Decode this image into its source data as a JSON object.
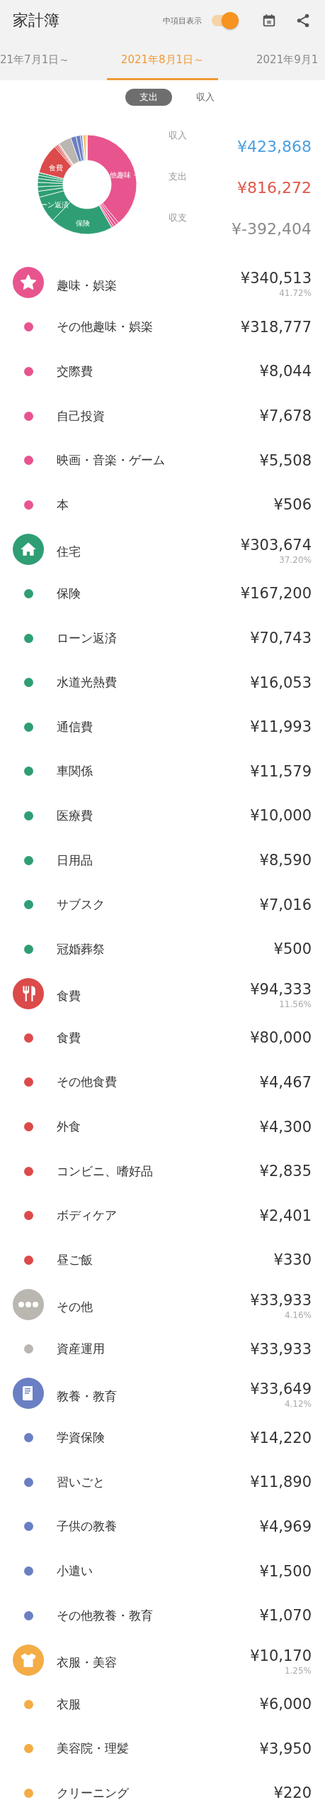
{
  "app_bar": {
    "title": "家計簿",
    "toggle": {
      "label": "中項目表示",
      "on": true
    }
  },
  "period_tabs": [
    {
      "label": "21年7月1日～",
      "selected": false
    },
    {
      "label": "2021年8月1日～",
      "selected": true
    },
    {
      "label": "2021年9月1",
      "selected": false
    }
  ],
  "mode_tabs": [
    {
      "label": "支出",
      "selected": true
    },
    {
      "label": "収入",
      "selected": false
    }
  ],
  "donut_labels": [
    "食費",
    "他趣味・",
    "ーン返済",
    "保険"
  ],
  "summary": [
    {
      "label": "収入",
      "value": "¥423,868",
      "kind": "income"
    },
    {
      "label": "支出",
      "value": "¥816,272",
      "kind": "expense"
    },
    {
      "label": "収支",
      "value": "¥-392,404",
      "kind": "balance"
    }
  ],
  "categories": [
    {
      "name": "趣味・娯楽",
      "amount": "¥340,513",
      "percent": "41.72%",
      "color": "#e8548e",
      "items": [
        {
          "name": "その他趣味・娯楽",
          "amount": "¥318,777"
        },
        {
          "name": "交際費",
          "amount": "¥8,044"
        },
        {
          "name": "自己投資",
          "amount": "¥7,678"
        },
        {
          "name": "映画・音楽・ゲーム",
          "amount": "¥5,508"
        },
        {
          "name": "本",
          "amount": "¥506"
        }
      ]
    },
    {
      "name": "住宅",
      "amount": "¥303,674",
      "percent": "37.20%",
      "color": "#2f9e74",
      "items": [
        {
          "name": "保険",
          "amount": "¥167,200"
        },
        {
          "name": "ローン返済",
          "amount": "¥70,743"
        },
        {
          "name": "水道光熱費",
          "amount": "¥16,053"
        },
        {
          "name": "通信費",
          "amount": "¥11,993"
        },
        {
          "name": "車関係",
          "amount": "¥11,579"
        },
        {
          "name": "医療費",
          "amount": "¥10,000"
        },
        {
          "name": "日用品",
          "amount": "¥8,590"
        },
        {
          "name": "サブスク",
          "amount": "¥7,016"
        },
        {
          "name": "冠婚葬祭",
          "amount": "¥500"
        }
      ]
    },
    {
      "name": "食費",
      "amount": "¥94,333",
      "percent": "11.56%",
      "color": "#dc4a4a",
      "items": [
        {
          "name": "食費",
          "amount": "¥80,000"
        },
        {
          "name": "その他食費",
          "amount": "¥4,467"
        },
        {
          "name": "外食",
          "amount": "¥4,300"
        },
        {
          "name": "コンビニ、嗜好品",
          "amount": "¥2,835"
        },
        {
          "name": "ボディケア",
          "amount": "¥2,401"
        },
        {
          "name": "昼ご飯",
          "amount": "¥330"
        }
      ]
    },
    {
      "name": "その他",
      "amount": "¥33,933",
      "percent": "4.16%",
      "color": "#bab6b0",
      "items": [
        {
          "name": "資産運用",
          "amount": "¥33,933"
        }
      ]
    },
    {
      "name": "教養・教育",
      "amount": "¥33,649",
      "percent": "4.12%",
      "color": "#6a7fc4",
      "items": [
        {
          "name": "学資保険",
          "amount": "¥14,220"
        },
        {
          "name": "習いごと",
          "amount": "¥11,890"
        },
        {
          "name": "子供の教養",
          "amount": "¥4,969"
        },
        {
          "name": "小遣い",
          "amount": "¥1,500"
        },
        {
          "name": "その他教養・教育",
          "amount": "¥1,070"
        }
      ]
    },
    {
      "name": "衣服・美容",
      "amount": "¥10,170",
      "percent": "1.25%",
      "color": "#f4ac45",
      "items": [
        {
          "name": "衣服",
          "amount": "¥6,000"
        },
        {
          "name": "美容院・理髪",
          "amount": "¥3,950"
        },
        {
          "name": "クリーニング",
          "amount": "¥220"
        }
      ]
    }
  ]
}
